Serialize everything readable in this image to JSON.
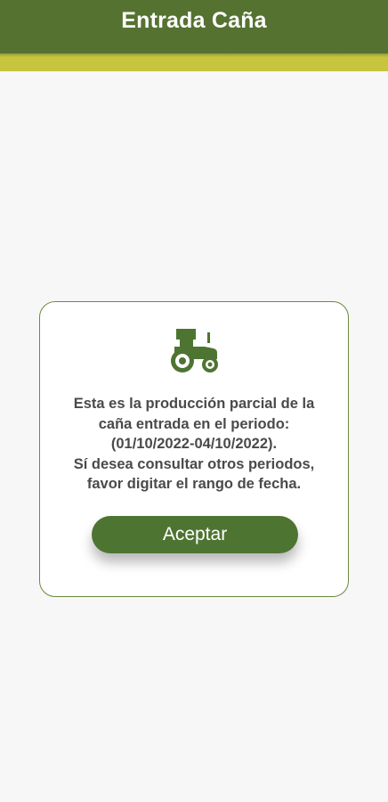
{
  "header": {
    "title": "Entrada Caña"
  },
  "colors": {
    "header_bg": "#557231",
    "accent_bar": "#c7c43d",
    "primary_green": "#4e7432",
    "dialog_border": "#6b8a3f"
  },
  "dialog": {
    "icon": "tractor-icon",
    "message_lines": [
      "Esta es la producción parcial de la",
      "caña entrada en el periodo:",
      "(01/10/2022-04/10/2022).",
      "Sí desea consultar otros periodos,",
      "favor digitar el rango de fecha."
    ],
    "accept_label": "Aceptar"
  }
}
